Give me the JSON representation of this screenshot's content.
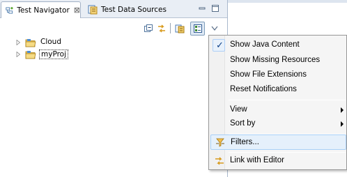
{
  "tabs": {
    "active": {
      "label": "Test Navigator",
      "close_glyph": "⊠"
    },
    "inactive": {
      "label": "Test Data Sources"
    }
  },
  "view_controls": {
    "minimize": "minimize-icon",
    "maximize": "maximize-icon",
    "view_menu": "view-menu-chevron-icon"
  },
  "toolbar": {
    "icons": [
      "collapse-all-icon",
      "link-with-editor-icon",
      "new-project-icon",
      "filter-view-icon"
    ]
  },
  "tree": {
    "items": [
      {
        "label": "Cloud",
        "icon": "folder-icon"
      },
      {
        "label": "myProj",
        "icon": "folder-icon"
      }
    ]
  },
  "context_menu": {
    "items": [
      {
        "label": "Show Java Content",
        "checked": true
      },
      {
        "label": "Show Missing Resources"
      },
      {
        "label": "Show File Extensions"
      },
      {
        "label": "Reset Notifications"
      },
      {
        "label": "View",
        "submenu": true
      },
      {
        "label": "Sort by",
        "submenu": true
      },
      {
        "label": "Filters...",
        "icon": "filters-icon",
        "hover": true
      },
      {
        "label": "Link with Editor",
        "icon": "link-with-editor-icon"
      }
    ]
  },
  "colors": {
    "tabbar_bg": "#e9eef5",
    "menu_bg": "#f5f5f5",
    "hover_bg": "#e5f0fb",
    "hover_border": "#a8d0f7"
  }
}
